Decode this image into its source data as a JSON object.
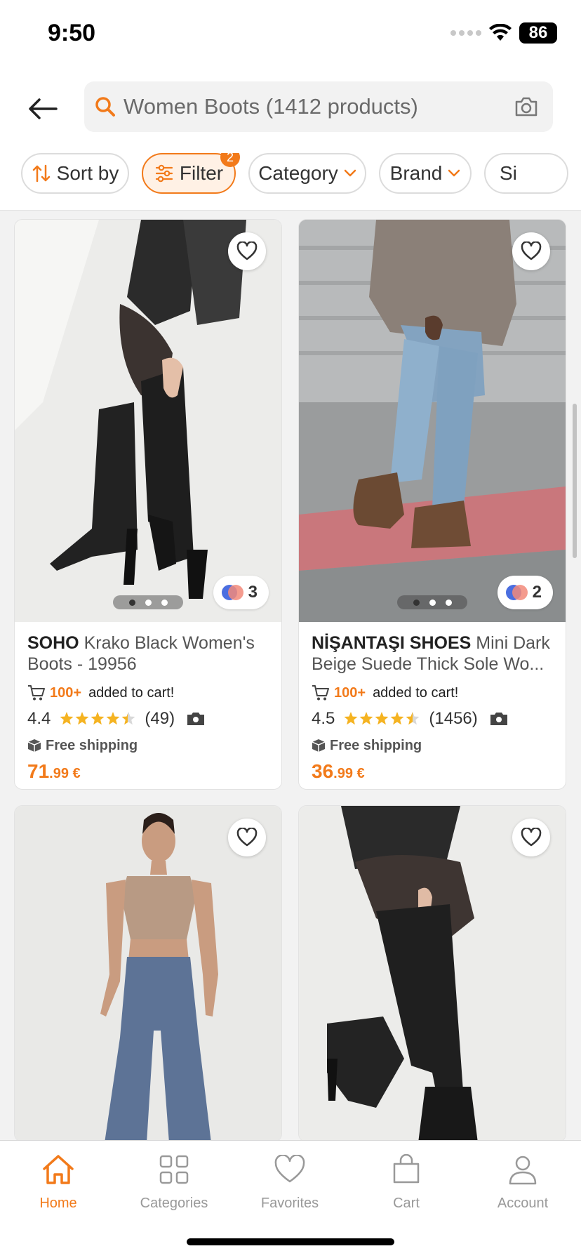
{
  "status_bar": {
    "time": "9:50",
    "battery": "86"
  },
  "header": {
    "search_text": "Women Boots (1412 products)",
    "chips": [
      {
        "label": "Sort by",
        "icon": "sort-arrows-icon"
      },
      {
        "label": "Filter",
        "icon": "sliders-icon",
        "badge": "2",
        "active": true
      },
      {
        "label": "Category",
        "icon": "chevron-down-icon"
      },
      {
        "label": "Brand",
        "icon": "chevron-down-icon"
      },
      {
        "label": "Si"
      }
    ]
  },
  "products": [
    {
      "brand": "SOHO",
      "name": "Krako Black Women's Boots - 19956",
      "color_count": "3",
      "cart_count": "100+",
      "cart_label": "added to cart!",
      "rating": "4.4",
      "reviews": "(49)",
      "shipping": "Free shipping",
      "price_int": "71",
      "price_dec": ".99 €"
    },
    {
      "brand": "NİŞANTAŞI SHOES",
      "name": "Mini Dark Beige Suede Thick Sole Wo...",
      "color_count": "2",
      "cart_count": "100+",
      "cart_label": "added to cart!",
      "rating": "4.5",
      "reviews": "(1456)",
      "shipping": "Free shipping",
      "price_int": "36",
      "price_dec": ".99 €"
    }
  ],
  "bottom_nav": [
    {
      "label": "Home",
      "active": true
    },
    {
      "label": "Categories"
    },
    {
      "label": "Favorites"
    },
    {
      "label": "Cart"
    },
    {
      "label": "Account"
    }
  ],
  "colors": {
    "accent": "#f27a1a",
    "star": "#f5b321"
  }
}
